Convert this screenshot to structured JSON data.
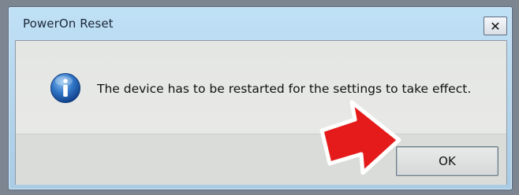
{
  "dialog": {
    "title": "PowerOn Reset",
    "close_glyph": "✕",
    "message": "The device has to be restarted for the settings to take effect.",
    "icon": "info-icon",
    "ok_label": "OK"
  },
  "annotation": {
    "icon": "red-arrow-icon",
    "color": "#e51b1b"
  }
}
